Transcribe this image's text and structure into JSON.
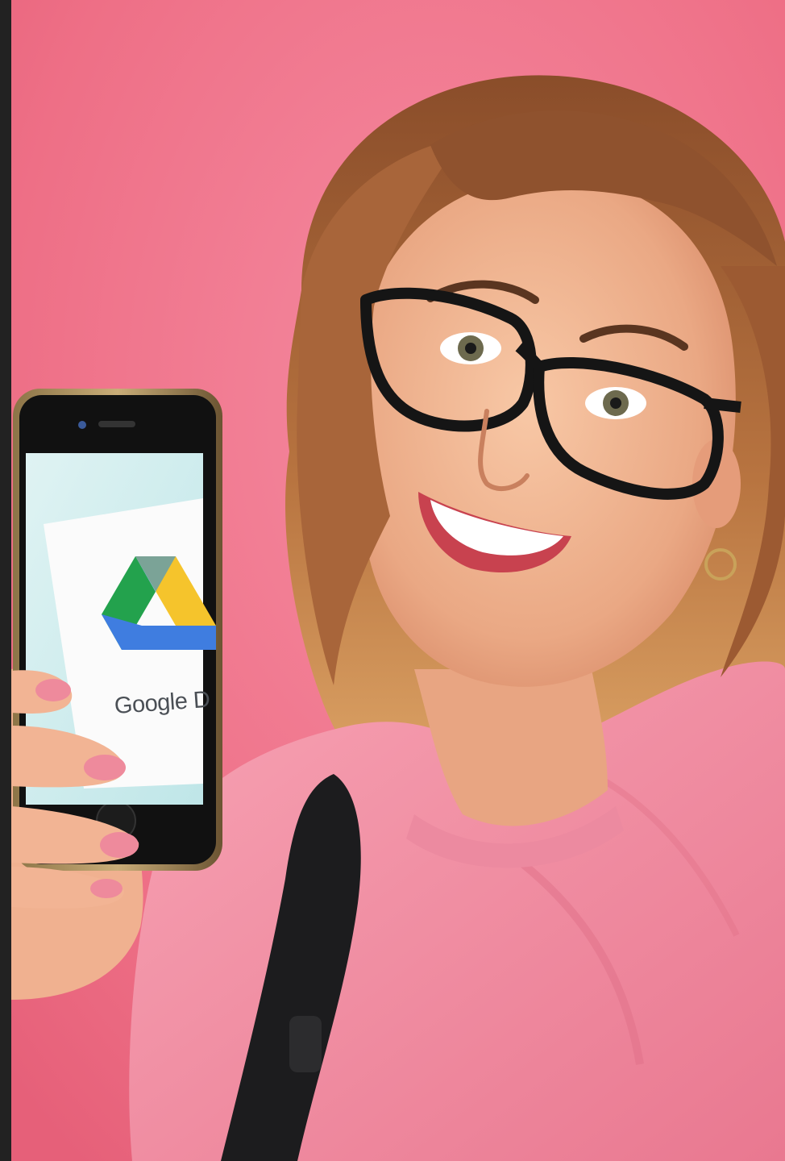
{
  "photo": {
    "phone_screen": {
      "logo_text": "Google Dr",
      "logo_icon": "google-drive-icon"
    }
  },
  "colors": {
    "background": "#f0758a",
    "frame_bar": "#222222",
    "shirt": "#f08fa3",
    "hair": "#9a5a33",
    "skin": "#f2b795",
    "glasses": "#1a1a1a",
    "phone_frame": "#7a6540",
    "drive_blue": "#3f7de0",
    "drive_green": "#23a24d",
    "drive_yellow": "#f5c42c"
  }
}
